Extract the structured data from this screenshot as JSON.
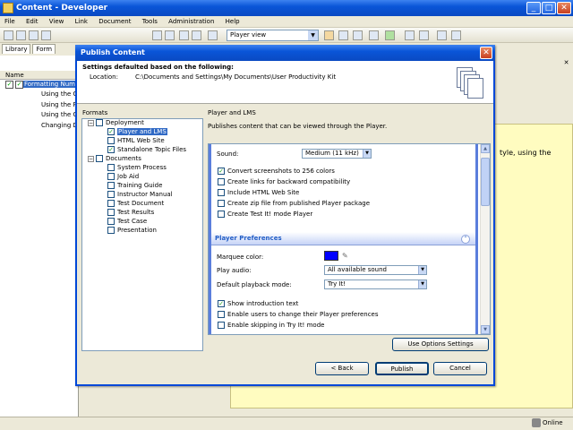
{
  "app": {
    "title": "Content - Developer",
    "menu": [
      "File",
      "Edit",
      "View",
      "Link",
      "Document",
      "Tools",
      "Administration",
      "Help"
    ],
    "view_mode": "Player view",
    "tabs": [
      "Library",
      "Form"
    ],
    "column_header": "Name",
    "tree": [
      "Formatting Numb",
      "Using the Cu",
      "Using the Per",
      "Using the Co",
      "Changing Dec"
    ],
    "background_text": "tyle, using the",
    "status": "Online"
  },
  "dialog": {
    "title": "Publish Content",
    "header_title": "Settings defaulted based on the following:",
    "location_label": "Location:",
    "location_value": "C:\\Documents and Settings\\My Documents\\User Productivity Kit",
    "formats_label": "Formats",
    "formats": {
      "deployment": "Deployment",
      "deployment_items": [
        {
          "label": "Player and LMS",
          "checked": true,
          "selected": true
        },
        {
          "label": "HTML Web Site",
          "checked": false
        },
        {
          "label": "Standalone Topic Files",
          "checked": true
        }
      ],
      "documents": "Documents",
      "documents_items": [
        "System Process",
        "Job Aid",
        "Training Guide",
        "Instructor Manual",
        "Test Document",
        "Test Results",
        "Test Case",
        "Presentation"
      ]
    },
    "panel_title": "Player and LMS",
    "panel_desc": "Publishes content that can be viewed through the Player.",
    "sound_label": "Sound:",
    "sound_value": "Medium (11 kHz)",
    "options": [
      {
        "label": "Convert screenshots to 256 colors",
        "checked": true
      },
      {
        "label": "Create links for backward compatibility",
        "checked": false
      },
      {
        "label": "Include HTML Web Site",
        "checked": false
      },
      {
        "label": "Create zip file from published Player package",
        "checked": false
      },
      {
        "label": "Create Test It! mode Player",
        "checked": false
      }
    ],
    "player_prefs_title": "Player Preferences",
    "marquee_label": "Marquee color:",
    "marquee_color": "#0000ff",
    "play_audio_label": "Play audio:",
    "play_audio_value": "All available sound",
    "playback_label": "Default playback mode:",
    "playback_value": "Try It!",
    "pref_options": [
      {
        "label": "Show introduction text",
        "checked": true
      },
      {
        "label": "Enable users to change their Player preferences",
        "checked": false
      },
      {
        "label": "Enable skipping in Try It! mode",
        "checked": false
      }
    ],
    "use_options_btn": "Use Options Settings",
    "back_btn": "< Back",
    "publish_btn": "Publish",
    "cancel_btn": "Cancel"
  }
}
